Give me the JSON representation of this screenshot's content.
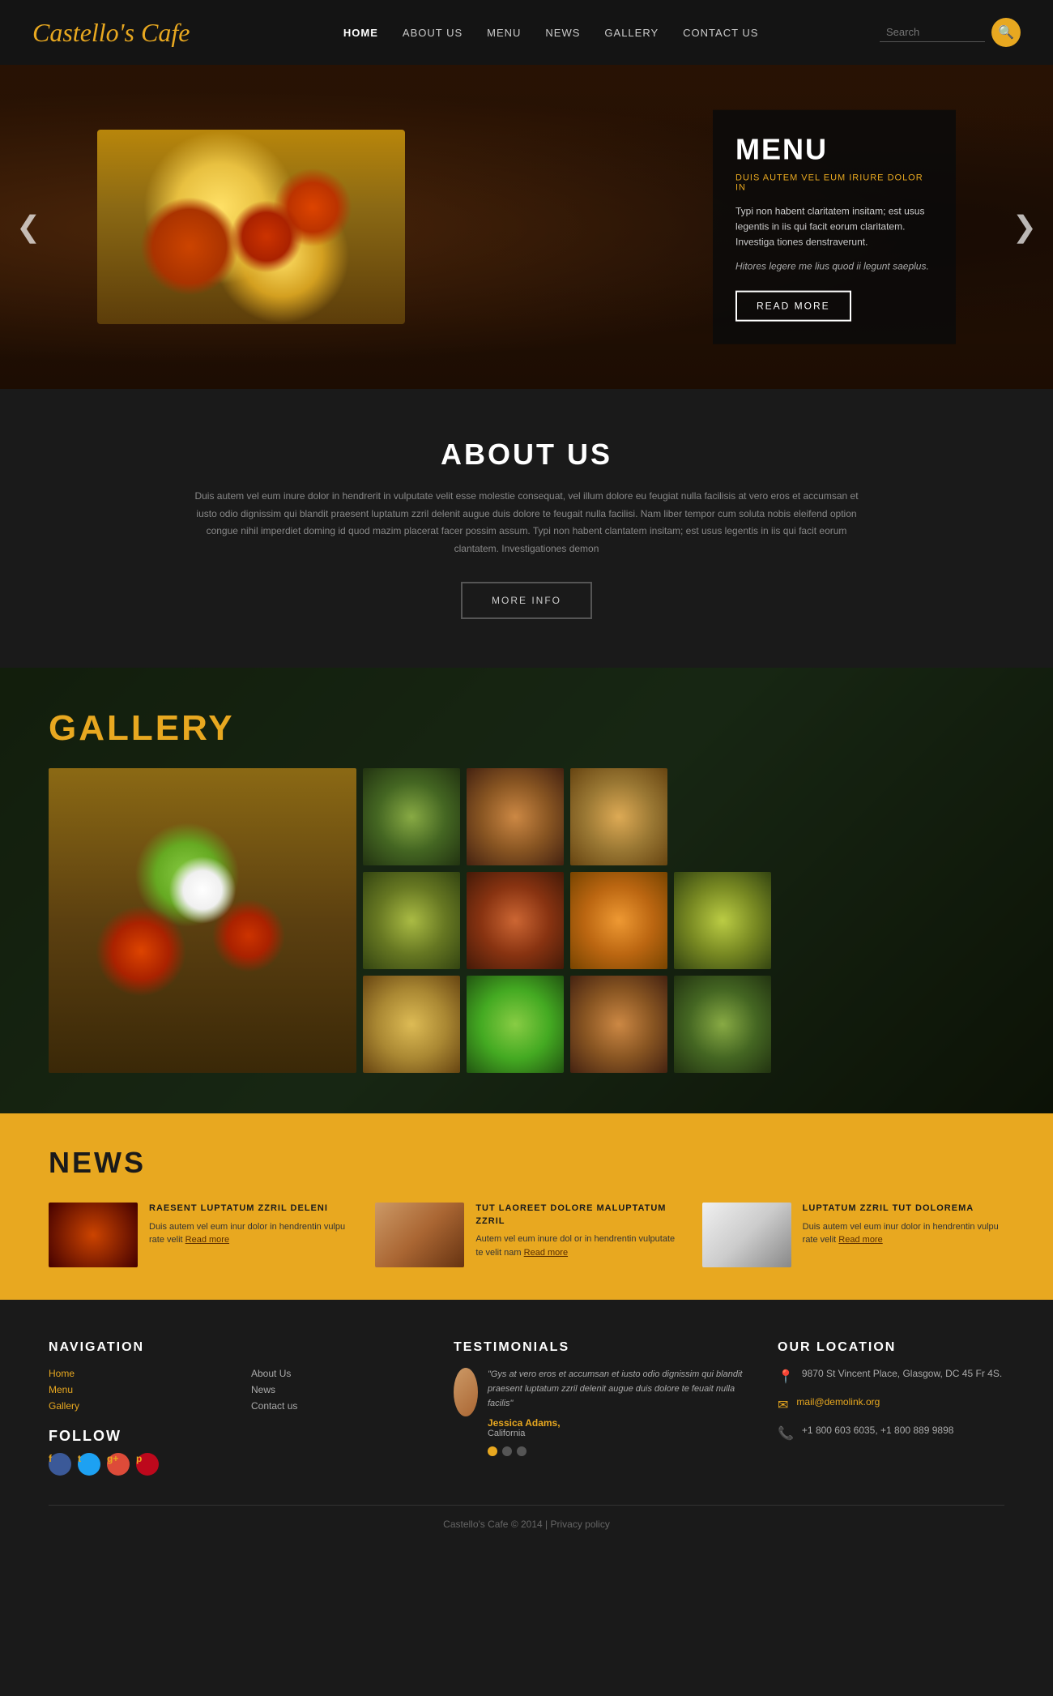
{
  "site": {
    "logo": "Castello's Cafe",
    "copyright": "Castello's Cafe © 2014 | Privacy policy"
  },
  "nav": {
    "items": [
      {
        "label": "HOME",
        "active": true
      },
      {
        "label": "ABOUT US",
        "active": false
      },
      {
        "label": "MENU",
        "active": false
      },
      {
        "label": "NEWS",
        "active": false
      },
      {
        "label": "GALLERY",
        "active": false
      },
      {
        "label": "CONTACT US",
        "active": false
      }
    ]
  },
  "search": {
    "placeholder": "Search",
    "button_icon": "🔍"
  },
  "hero": {
    "title": "MENU",
    "subtitle": "DUIS AUTEM VEL EUM IRIURE DOLOR IN",
    "body1": "Typi non habent claritatem insitam; est usus legentis in iis qui facit eorum claritatem. Investiga tiones denstraverunt.",
    "body2": "Hitores legere me lius quod ii legunt saeplus.",
    "cta": "READ MORE",
    "prev_icon": "❮",
    "next_icon": "❯"
  },
  "about": {
    "title": "ABOUT US",
    "body": "Duis autem vel eum inure dolor in hendrerit in vulputate velit esse molestie consequat, vel illum dolore eu feugiat nulla facilisis at vero eros et accumsan et iusto odio dignissim qui blandit praesent luptatum zzril delenit augue duis dolore te feugait nulla facilisi. Nam liber tempor cum soluta nobis eleifend option congue nihil imperdiet doming id quod mazim placerat facer possim assum. Typi non habent clantatem insitam; est usus legentis in iis qui facit eorum clantatem. Investigationes demon",
    "cta": "MORE INFO"
  },
  "gallery": {
    "title_part1": "GALL",
    "title_highlight": "E",
    "title_part2": "RY",
    "images": [
      {
        "id": 1,
        "alt": "main-dish"
      },
      {
        "id": 2,
        "alt": "salad-bowl"
      },
      {
        "id": 3,
        "alt": "meat-dish"
      },
      {
        "id": 4,
        "alt": "pasta"
      },
      {
        "id": 5,
        "alt": "fresh-salad"
      },
      {
        "id": 6,
        "alt": "grilled-veggies"
      },
      {
        "id": 7,
        "alt": "spicy-dish"
      },
      {
        "id": 8,
        "alt": "wraps"
      },
      {
        "id": 9,
        "alt": "noodle-dish"
      },
      {
        "id": 10,
        "alt": "fish-dish"
      }
    ]
  },
  "news": {
    "title": "NEWS",
    "items": [
      {
        "id": 1,
        "headline": "RAESENT LUPTATUM ZZRIL DELENI",
        "body": "Duis autem vel eum inur dolor in hendrentin vulpu rate velit",
        "read_more": "Read more"
      },
      {
        "id": 2,
        "headline": "TUT LAOREET DOLORE MALUPTATUM ZZRIL",
        "body": "Autem vel eum inure dol or in hendrentin vulputate te velit nam",
        "read_more": "Read more"
      },
      {
        "id": 3,
        "headline": "LUPTATUM ZZRIL TUT DOLOREMA",
        "body": "Duis autem vel eum inur dolor in hendrentin vulpu rate velit",
        "read_more": "Read more"
      }
    ]
  },
  "footer": {
    "navigation": {
      "title": "NAVIGATION",
      "col1": [
        "Home",
        "Menu",
        "Gallery"
      ],
      "col2": [
        "About Us",
        "News",
        "Contact us"
      ]
    },
    "follow": {
      "title": "FOLLOW",
      "socials": [
        {
          "name": "Facebook",
          "icon": "f",
          "class": "si-fb"
        },
        {
          "name": "Twitter",
          "icon": "t",
          "class": "si-tw"
        },
        {
          "name": "Google+",
          "icon": "g+",
          "class": "si-gp"
        },
        {
          "name": "Pinterest",
          "icon": "p",
          "class": "si-pi"
        }
      ]
    },
    "testimonials": {
      "title": "TESTIMONIALS",
      "quote": "\"Gys at vero eros et accumsan et iusto odio dignissim qui blandit praesent luptatum zzril delenit augue duis dolore te feuait nulla facilis\"",
      "author": "Jessica Adams,",
      "location": "California"
    },
    "location": {
      "title": "OUR LOCATION",
      "address": "9870 St Vincent Place, Glasgow, DC 45 Fr 4S.",
      "email": "mail@demolink.org",
      "phone": "+1 800 603 6035, +1 800 889 9898"
    },
    "copyright": "Castello's Cafe © 2014 | Privacy policy"
  }
}
